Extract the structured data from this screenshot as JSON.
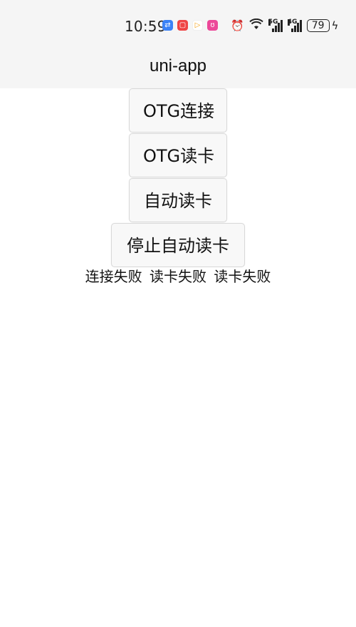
{
  "status_bar": {
    "time": "10:59",
    "app_icons": [
      {
        "name": "usb-app-icon",
        "color": "#3b82f6",
        "glyph": "⇄"
      },
      {
        "name": "red-app-icon",
        "color": "#ef4444",
        "glyph": "▢"
      },
      {
        "name": "play-app-icon",
        "color": "#ffffff",
        "glyph": "▷"
      },
      {
        "name": "pink-app-icon",
        "color": "#ec4899",
        "glyph": "ʊ"
      }
    ],
    "net1": "5G",
    "net2": "4G",
    "battery": "79"
  },
  "nav": {
    "title": "uni-app"
  },
  "buttons": {
    "otg_connect": "OTG连接",
    "otg_read": "OTG读卡",
    "auto_read": "自动读卡",
    "stop_auto_read": "停止自动读卡"
  },
  "results": [
    "连接失败",
    "读卡失败",
    "读卡失败"
  ]
}
